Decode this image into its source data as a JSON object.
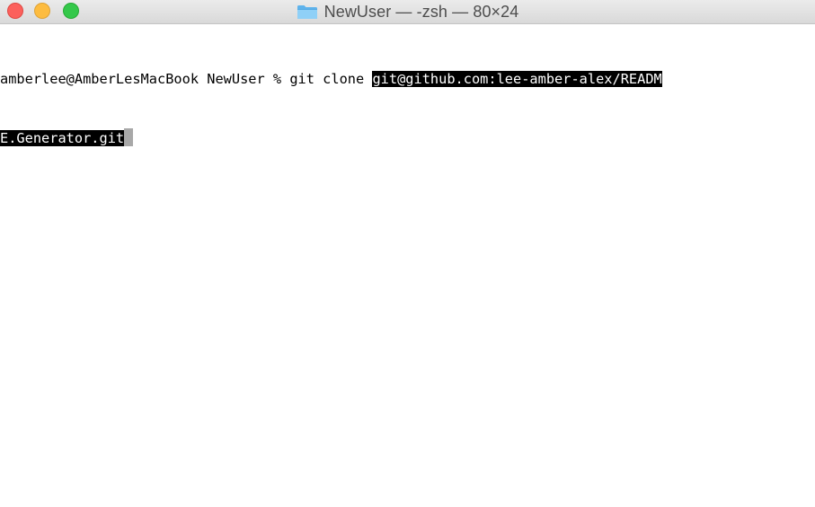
{
  "window": {
    "title": "NewUser — -zsh — 80×24",
    "folder_icon": "folder-icon",
    "buttons": {
      "close": "close-button",
      "minimize": "minimize-button",
      "zoom": "zoom-button"
    },
    "colors": {
      "close": "#fc605c",
      "minimize": "#fdbc40",
      "zoom": "#34c84a",
      "selection_bg": "#000000",
      "selection_fg": "#ffffff",
      "cursor": "#a8a8a8"
    }
  },
  "terminal": {
    "line1_prompt": "amberlee@AmberLesMacBook NewUser % git clone ",
    "line1_selected": "git@github.com:lee-amber-alex/READM",
    "line2_selected": "E.Generator.git"
  }
}
